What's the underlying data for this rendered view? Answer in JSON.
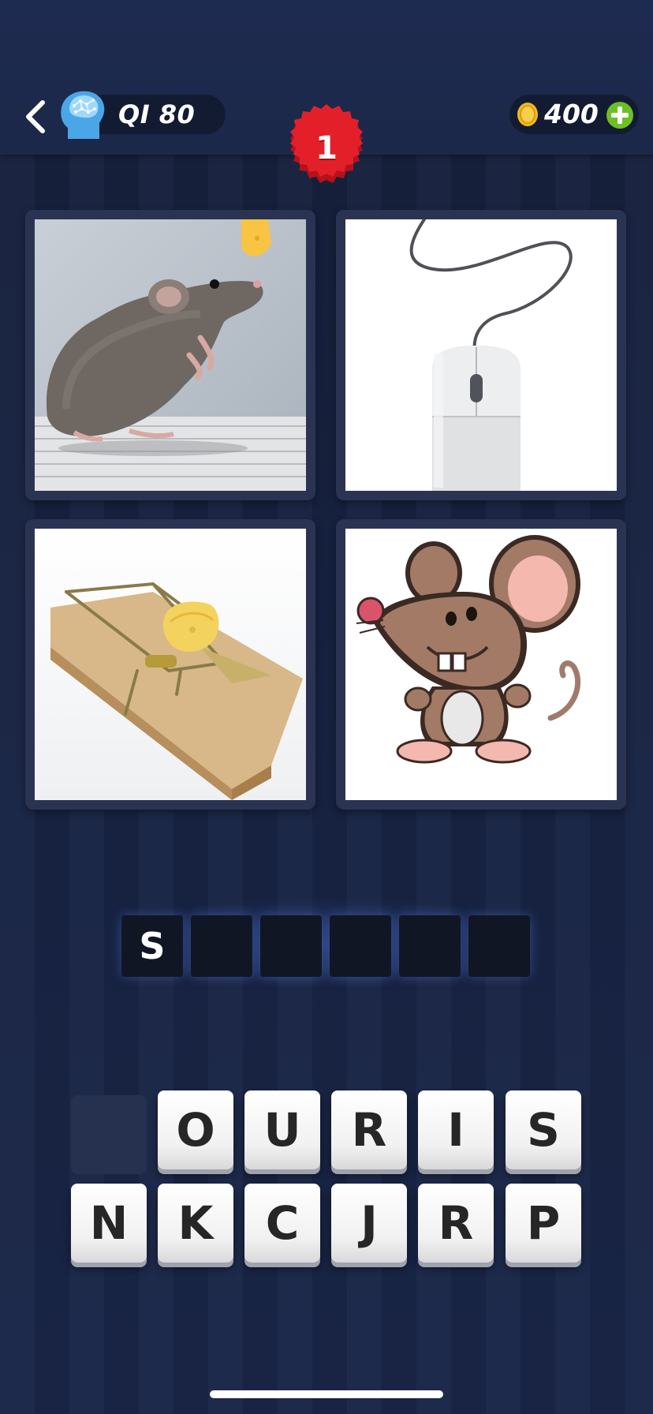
{
  "header": {
    "iq_label": "QI 80",
    "coins": "400",
    "level": "1"
  },
  "images": [
    {
      "icon": "mouse-animal-with-cheese"
    },
    {
      "icon": "computer-mouse"
    },
    {
      "icon": "mousetrap-with-cheese"
    },
    {
      "icon": "cartoon-mouse"
    }
  ],
  "answer_slots": [
    "S",
    "",
    "",
    "",
    "",
    ""
  ],
  "letter_keys": {
    "row1": [
      "",
      "O",
      "U",
      "R",
      "I",
      "S"
    ],
    "row2": [
      "N",
      "K",
      "C",
      "J",
      "R",
      "P"
    ]
  },
  "colors": {
    "background": "#16203b",
    "badge_red": "#e3202a",
    "coin_gold": "#f2b81e",
    "plus_green": "#6cc025"
  }
}
